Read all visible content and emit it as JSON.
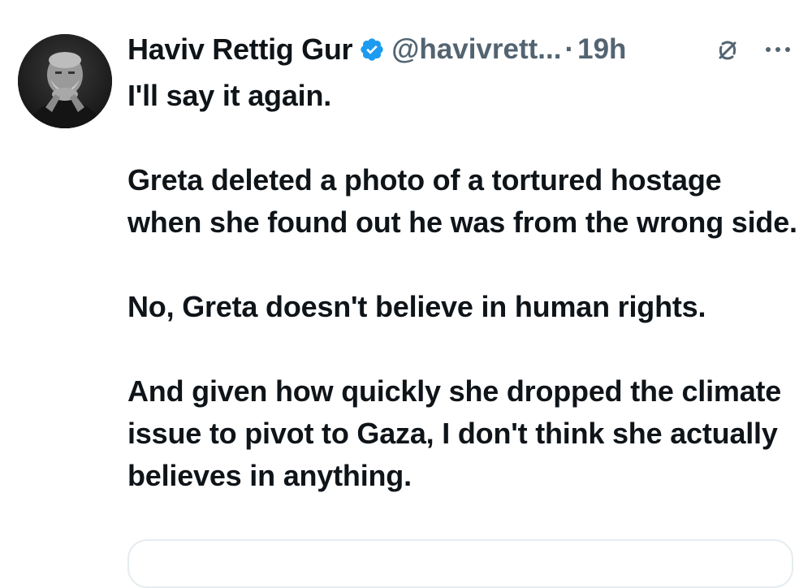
{
  "author": {
    "name": "Haviv Rettig Gur",
    "handle": "@havivrett...",
    "separator": "·",
    "time": "19h",
    "verified": true,
    "verified_color": "#1d9bf0"
  },
  "tweet": {
    "paragraphs": [
      "I'll say it again.",
      "Greta deleted a photo of a tortured hostage when she found out he was from the wrong side.",
      "No, Greta doesn't believe in human rights.",
      "And given how quickly she dropped the climate issue to pivot to Gaza, I don't think she actually believes in anything."
    ]
  },
  "icons": {
    "avatar": "avatar-photo",
    "verified": "verified-badge-icon",
    "grok": "grok-icon",
    "more": "more-options-icon"
  },
  "colors": {
    "text": "#0f1419",
    "secondary": "#536471",
    "border": "#e6ecf0"
  }
}
